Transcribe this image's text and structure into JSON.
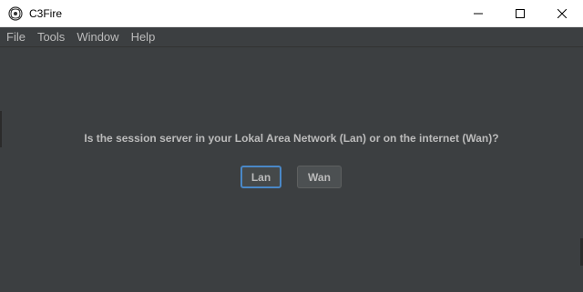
{
  "window": {
    "title": "C3Fire",
    "app_icon": "c3fire-logo-icon",
    "controls": [
      "minimize-icon",
      "maximize-icon",
      "close-icon"
    ]
  },
  "menu": {
    "items": [
      {
        "label": "File"
      },
      {
        "label": "Tools"
      },
      {
        "label": "Window"
      },
      {
        "label": "Help"
      }
    ]
  },
  "dialog": {
    "question": "Is the session server in your Lokal Area Network (Lan) or on the internet (Wan)?",
    "lan_label": "Lan",
    "wan_label": "Wan",
    "focused_button": "Lan"
  },
  "colors": {
    "background": "#3c3f41",
    "text": "#bbbbbb",
    "focus_accent": "#4a88c7"
  }
}
